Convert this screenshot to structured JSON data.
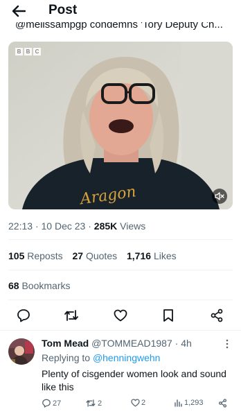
{
  "header": {
    "title": "Post",
    "back_icon": "arrow-left-icon"
  },
  "quoted_line": "@melissampgp condemns 'Tory Deputy Ch...",
  "media": {
    "broadcaster_logo": [
      "B",
      "B",
      "C"
    ],
    "shirt_text": "Aragon",
    "mute_icon": "volume-muted-icon"
  },
  "meta": {
    "time": "22:13",
    "separator": "·",
    "date": "10 Dec 23",
    "views_count": "285K",
    "views_label": "Views"
  },
  "stats": {
    "reposts_count": "105",
    "reposts_label": "Reposts",
    "quotes_count": "27",
    "quotes_label": "Quotes",
    "likes_count": "1,716",
    "likes_label": "Likes",
    "bookmarks_count": "68",
    "bookmarks_label": "Bookmarks"
  },
  "actions": [
    "reply-icon",
    "repost-icon",
    "like-icon",
    "bookmark-icon",
    "share-icon"
  ],
  "reply": {
    "name": "Tom Mead",
    "handle": "@TOMMEAD1987",
    "separator": "·",
    "time": "4h",
    "replying_prefix": "Replying to",
    "replying_to": "@henningwehn",
    "text": "Plenty of cisgender women look and sound like this",
    "replies": "27",
    "reposts": "2",
    "likes": "2",
    "views": "1,293"
  }
}
